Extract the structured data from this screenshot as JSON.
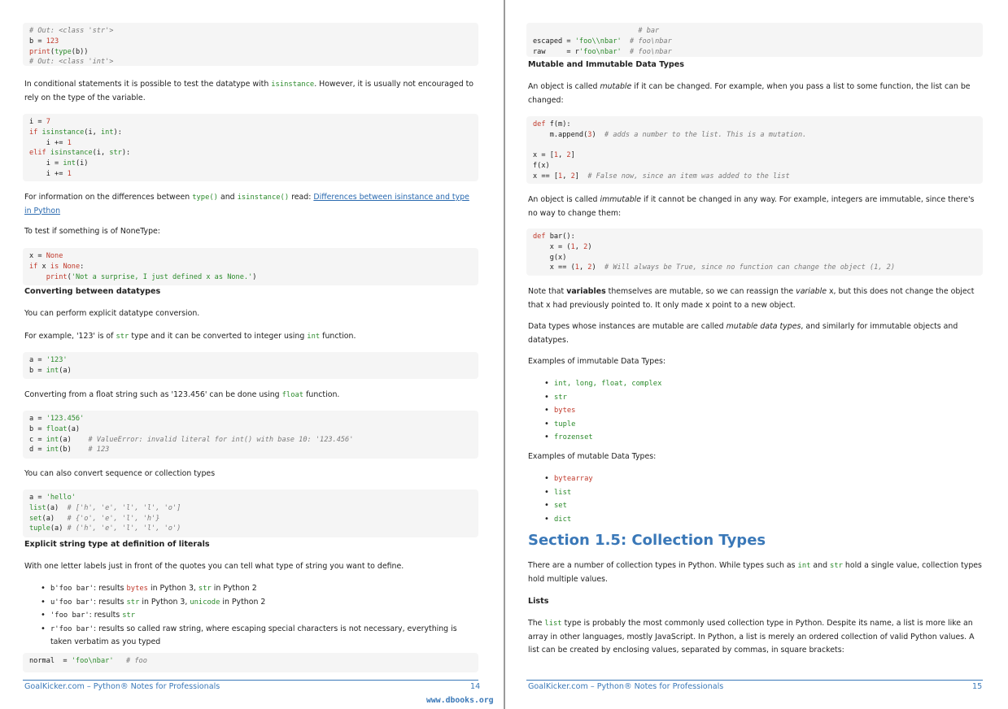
{
  "left": {
    "code1": [
      "# Out: <class 'str'>",
      "b = 123",
      "print(type(b))",
      "# Out: <class 'int'>"
    ],
    "p_isinstance": {
      "pre": "In conditional statements it is possible to test the datatype with ",
      "code": "isinstance",
      "post": ". However, it is usually not encouraged to rely on the type of the variable."
    },
    "code2": [
      "i = 7",
      "if isinstance(i, int):",
      "    i += 1",
      "elif isinstance(i, str):",
      "    i = int(i)",
      "    i += 1"
    ],
    "p_diff": {
      "pre": "For information on the differences between ",
      "code1": "type()",
      "mid": " and ",
      "code2": "isinstance()",
      "post": " read: ",
      "link": "Differences between isinstance and type in Python"
    },
    "p_nonetype": "To test if something is of NoneType:",
    "code3": [
      "x = None",
      "if x is None:",
      "    print('Not a surprise, I just defined x as None.')"
    ],
    "h_converting": "Converting between datatypes",
    "p_explicit": "You can perform explicit datatype conversion.",
    "p_example": {
      "pre": "For example, '123' is of ",
      "code1": "str",
      "mid": " type and it can be converted to integer using ",
      "code2": "int",
      "post": " function."
    },
    "code4": [
      "a = '123'",
      "b = int(a)"
    ],
    "p_float": {
      "pre": "Converting from a float string such as '123.456' can be done using ",
      "code": "float",
      "post": " function."
    },
    "code5": [
      "a = '123.456'",
      "b = float(a)",
      "c = int(a)    # ValueError: invalid literal for int() with base 10: '123.456'",
      "d = int(b)    # 123"
    ],
    "p_sequence": "You can also convert sequence or collection types",
    "code6": [
      "a = 'hello'",
      "list(a)  # ['h', 'e', 'l', 'l', 'o']",
      "set(a)   # {'o', 'e', 'l', 'h'}",
      "tuple(a) # ('h', 'e', 'l', 'l', 'o')"
    ],
    "h_explicit_string": "Explicit string type at definition of literals",
    "p_letter": "With one letter labels just in front of the quotes you can tell what type of string you want to define.",
    "bullets": [
      {
        "code": "b'foo bar'",
        "t1": ": results ",
        "c1": "bytes",
        "t2": " in Python 3, ",
        "c2": "str",
        "t3": " in Python 2"
      },
      {
        "code": "u'foo bar'",
        "t1": ": results ",
        "c1": "str",
        "t2": " in Python 3, ",
        "c2": "unicode",
        "t3": " in Python 2"
      },
      {
        "code": "'foo bar'",
        "t1": ": results ",
        "c1": "str",
        "t2": "",
        "c2": "",
        "t3": ""
      },
      {
        "code": "r'foo bar'",
        "t1": ": results so called raw string, where escaping special characters is not necessary, everything is taken verbatim as you typed",
        "c1": "",
        "t2": "",
        "c2": "",
        "t3": ""
      }
    ],
    "code7": [
      "normal  = 'foo\\nbar'   # foo"
    ],
    "footer_left": "GoalKicker.com – Python® Notes for Professionals",
    "footer_page": "14",
    "watermark": "www.dbooks.org"
  },
  "right": {
    "code1": [
      "                         # bar",
      "escaped = 'foo\\\\nbar'  # foo\\nbar",
      "raw     = r'foo\\nbar'  # foo\\nbar"
    ],
    "h_mutable": "Mutable and Immutable Data Types",
    "p_mutable": {
      "pre": "An object is called ",
      "em": "mutable",
      "post": " if it can be changed. For example, when you pass a list to some function, the list can be changed:"
    },
    "code2": [
      "def f(m):",
      "    m.append(3)  # adds a number to the list. This is a mutation.",
      "",
      "x = [1, 2]",
      "f(x)",
      "x == [1, 2]  # False now, since an item was added to the list"
    ],
    "p_immutable": {
      "pre": "An object is called ",
      "em": "immutable",
      "post": " if it cannot be changed in any way. For example, integers are immutable, since there's no way to change them:"
    },
    "code3": [
      "def bar():",
      "    x = (1, 2)",
      "    g(x)",
      "    x == (1, 2)  # Will always be True, since no function can change the object (1, 2)"
    ],
    "p_variables": {
      "pre": "Note that ",
      "b": "variables",
      "mid": " themselves are mutable, so we can reassign the ",
      "em": "variable",
      "post": " x, but this does not change the object that x had previously pointed to. It only made x point to a new object."
    },
    "p_datatypes": {
      "pre": "Data types whose instances are mutable are called ",
      "em": "mutable data types",
      "post": ", and similarly for immutable objects and datatypes."
    },
    "p_ex_immutable": "Examples of immutable Data Types:",
    "immutable_items": [
      "int, long, float, complex",
      "str",
      "bytes",
      "tuple",
      "frozenset"
    ],
    "p_ex_mutable": "Examples of mutable Data Types:",
    "mutable_items": [
      "bytearray",
      "list",
      "set",
      "dict"
    ],
    "section_title": "Section 1.5: Collection Types",
    "p_collection": {
      "pre": "There are a number of collection types in Python. While types such as ",
      "c1": "int",
      "mid": " and ",
      "c2": "str",
      "post": " hold a single value, collection types hold multiple values."
    },
    "h_lists": "Lists",
    "p_lists": {
      "pre": "The ",
      "code": "list",
      "post": " type is probably the most commonly used collection type in Python. Despite its name, a list is more like an array in other languages, mostly JavaScript. In Python, a list is merely an ordered collection of valid Python values. A list can be created by enclosing values, separated by commas, in square brackets:"
    },
    "footer_left": "GoalKicker.com – Python® Notes for Professionals",
    "footer_page": "15"
  }
}
